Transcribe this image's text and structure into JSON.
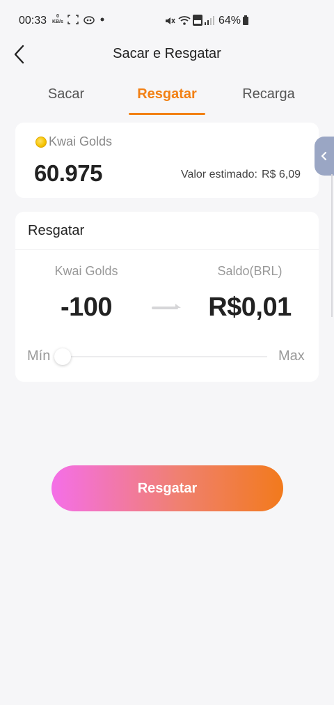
{
  "status_bar": {
    "time": "00:33",
    "speed_value": "0",
    "speed_unit": "KB/s",
    "battery": "64%"
  },
  "header": {
    "title": "Sacar e Resgatar"
  },
  "tabs": [
    {
      "label": "Sacar",
      "active": false
    },
    {
      "label": "Resgatar",
      "active": true
    },
    {
      "label": "Recarga",
      "active": false
    }
  ],
  "balance": {
    "currency_label": "Kwai Golds",
    "amount": "60.975",
    "estimated_label": "Valor estimado:",
    "estimated_value": "R$ 6,09"
  },
  "redeem": {
    "title": "Resgatar",
    "from_label": "Kwai Golds",
    "from_value": "-100",
    "to_label": "Saldo(BRL)",
    "to_value": "R$0,01",
    "slider_min_label": "Mín",
    "slider_max_label": "Max",
    "slider_position": 0
  },
  "button": {
    "label": "Resgatar"
  },
  "colors": {
    "accent": "#f28014",
    "background": "#f6f6f8",
    "button_gradient_start": "#f46fe8",
    "button_gradient_end": "#f27a1c",
    "side_tab": "#9aa6c4"
  },
  "icons": {
    "back": "chevron-left-icon",
    "coin": "coin-icon",
    "arrow": "arrow-right-icon",
    "side_tab": "chevron-left-icon"
  }
}
